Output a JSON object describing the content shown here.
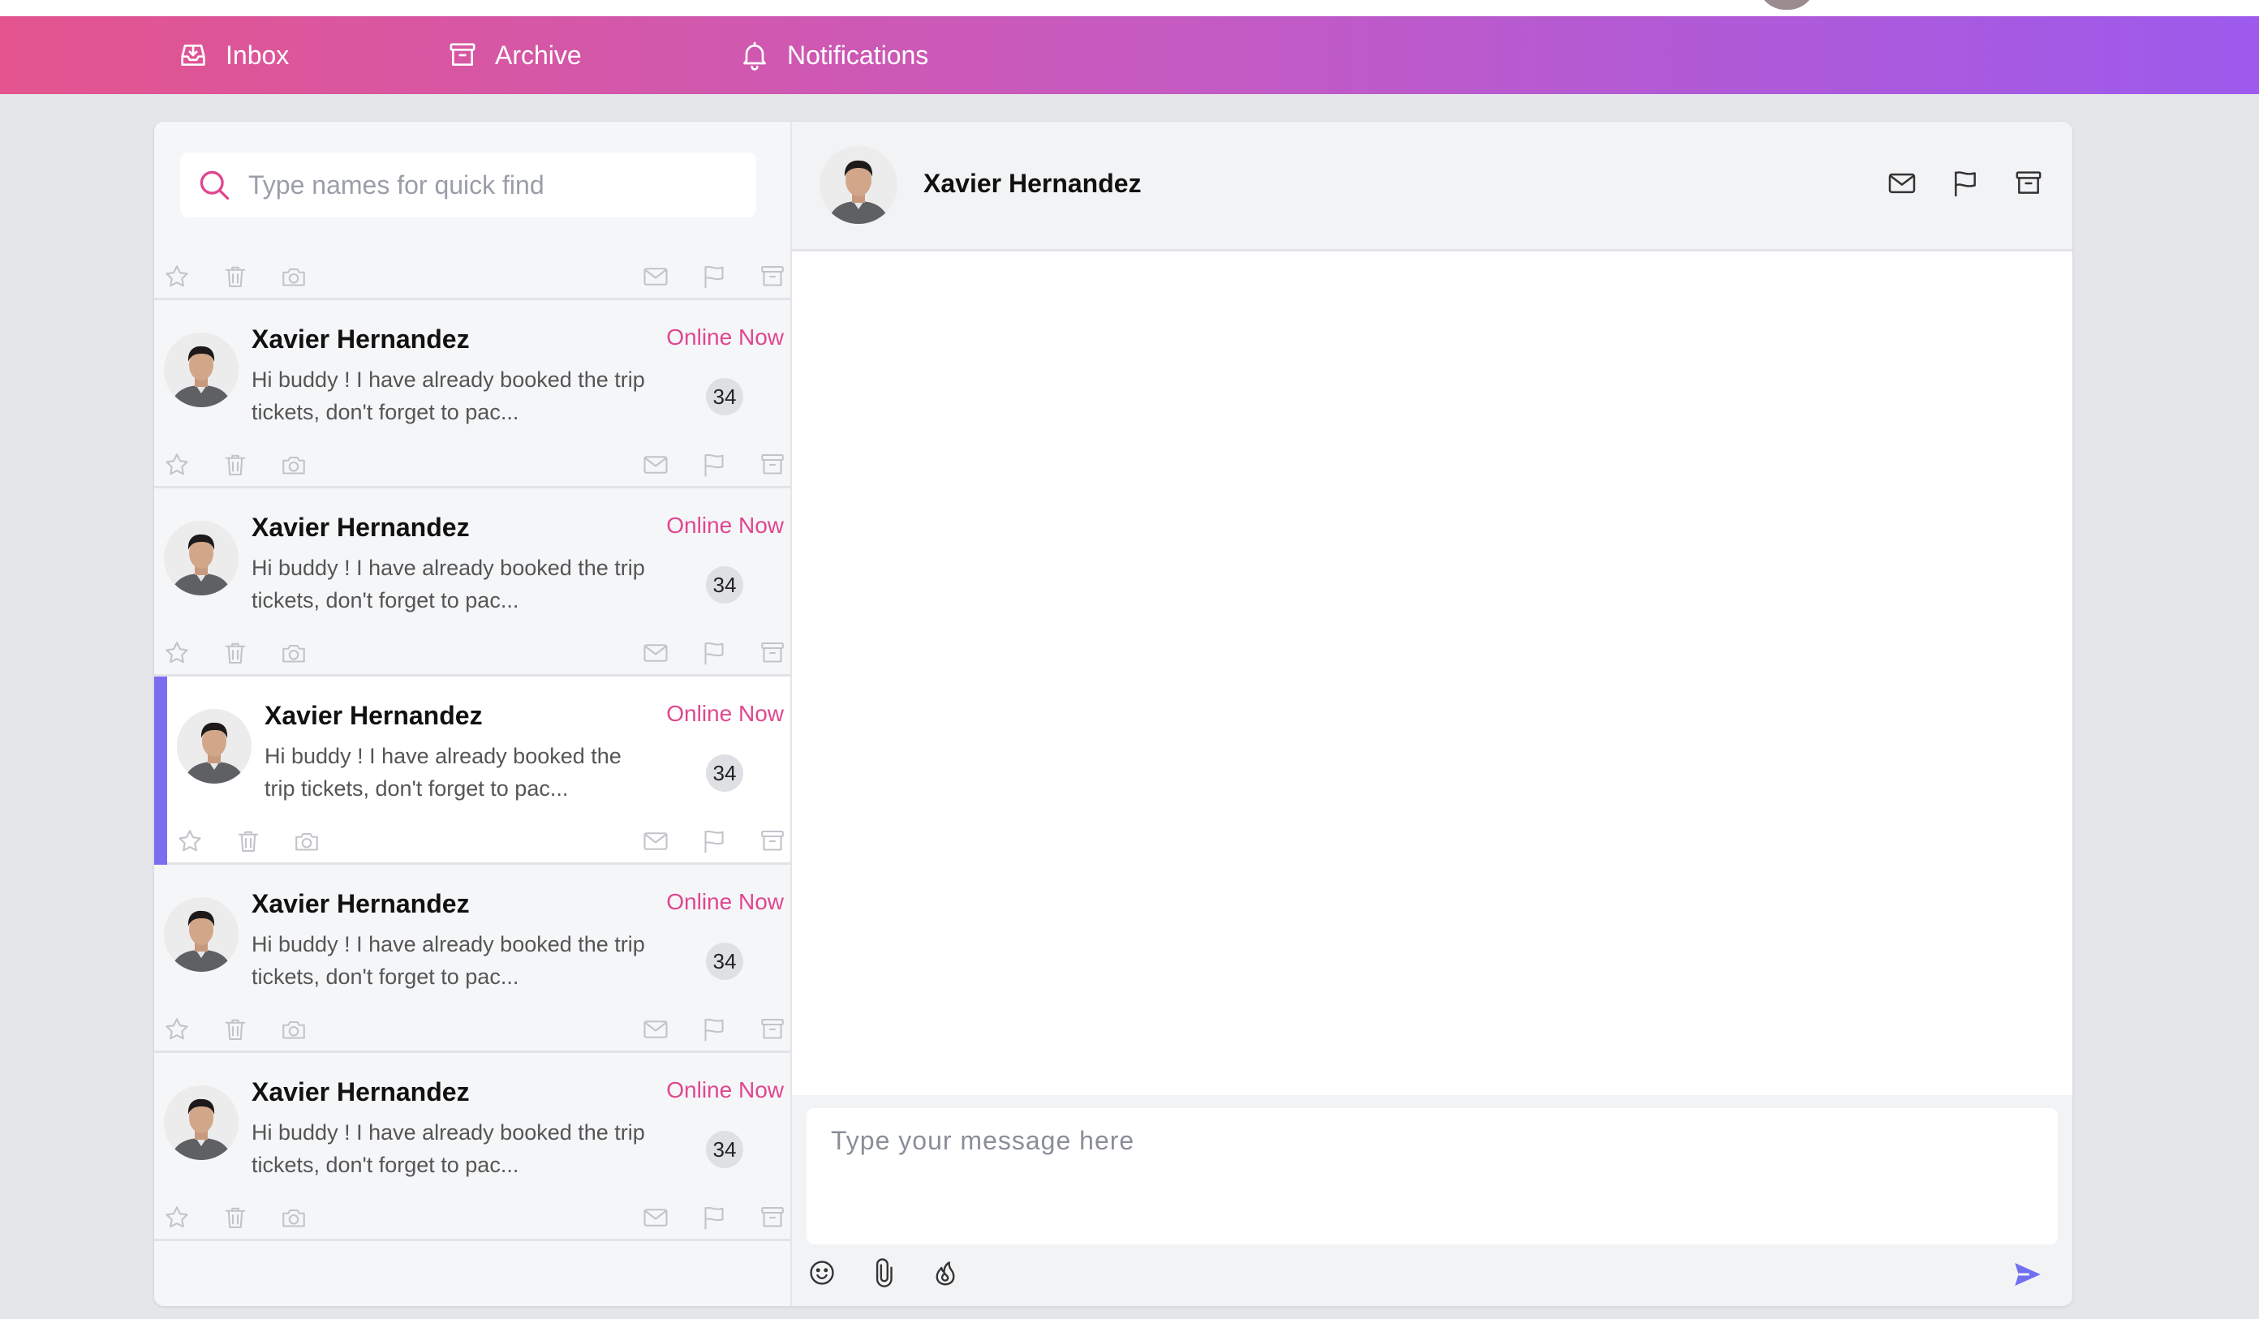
{
  "nav": {
    "inbox": "Inbox",
    "archive": "Archive",
    "notifications": "Notifications"
  },
  "search": {
    "placeholder": "Type names for quick find"
  },
  "conversations": [
    {
      "name": "Xavier Hernandez",
      "status": "Online Now",
      "preview": "Hi buddy ! I have already booked the trip tickets, don't forget to pac...",
      "count": "34"
    },
    {
      "name": "Xavier Hernandez",
      "status": "Online Now",
      "preview": "Hi buddy ! I have already booked the trip tickets, don't forget to pac...",
      "count": "34"
    },
    {
      "name": "Xavier Hernandez",
      "status": "Online Now",
      "preview": "Hi buddy ! I have already booked the trip tickets, don't forget to pac...",
      "count": "34"
    },
    {
      "name": "Xavier Hernandez",
      "status": "Online Now",
      "preview": "Hi buddy ! I have already booked the trip tickets, don't forget to pac...",
      "count": "34",
      "active": true
    },
    {
      "name": "Xavier Hernandez",
      "status": "Online Now",
      "preview": "Hi buddy ! I have already booked the trip tickets, don't forget to pac...",
      "count": "34"
    },
    {
      "name": "Xavier Hernandez",
      "status": "Online Now",
      "preview": "Hi buddy ! I have already booked the trip tickets, don't forget to pac...",
      "count": "34"
    }
  ],
  "chat": {
    "contact_name": "Xavier Hernandez",
    "composer_placeholder": "Type your message here"
  },
  "colors": {
    "accent_pink": "#e0468f",
    "accent_purple": "#7b6cf0",
    "nav_gradient_start": "#e3548e",
    "nav_gradient_end": "#9d5aec"
  },
  "icons": {
    "nav": [
      "inbox-icon",
      "archive-icon",
      "bell-icon"
    ],
    "row_left": [
      "star-icon",
      "trash-icon",
      "camera-icon"
    ],
    "row_right": [
      "mail-icon",
      "flag-icon",
      "archive-icon"
    ],
    "header": [
      "mail-icon",
      "flag-icon",
      "archive-icon"
    ],
    "composer": [
      "emoji-icon",
      "paperclip-icon",
      "flame-icon",
      "send-icon"
    ]
  }
}
